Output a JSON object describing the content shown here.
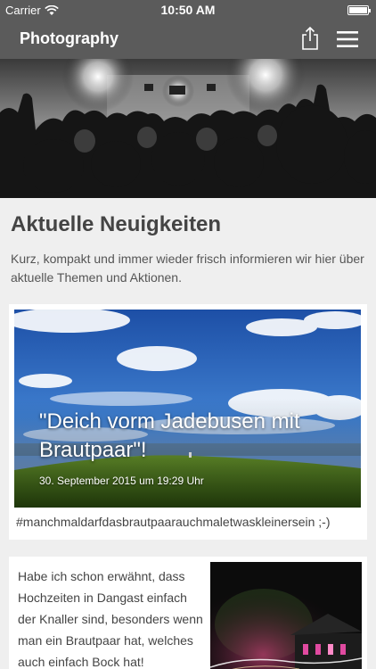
{
  "status_bar": {
    "carrier": "Carrier",
    "time": "10:50 AM"
  },
  "nav": {
    "title": "Photography"
  },
  "section": {
    "title": "Aktuelle Neuigkeiten",
    "intro": "Kurz, kompakt und immer wieder frisch informieren wir hier über aktuelle Themen und Aktionen."
  },
  "posts": [
    {
      "title": "\"Deich vorm Jadebusen mit Brautpaar\"!",
      "date": "30. September 2015 um 19:29 Uhr",
      "caption": "#manchmaldarfdasbrautpaarauchmaletwaskleinersein ;-)"
    },
    {
      "excerpt": "Habe ich schon erwähnt, dass Hochzeiten in Dangast einfach der Knaller sind, besonders wenn man ein Brautpaar hat, welches auch einfach Bock hat!"
    }
  ],
  "colors": {
    "nav_bg": "#5b5b5b",
    "page_bg": "#efefef",
    "card_bg": "#ffffff",
    "text": "#444444"
  }
}
